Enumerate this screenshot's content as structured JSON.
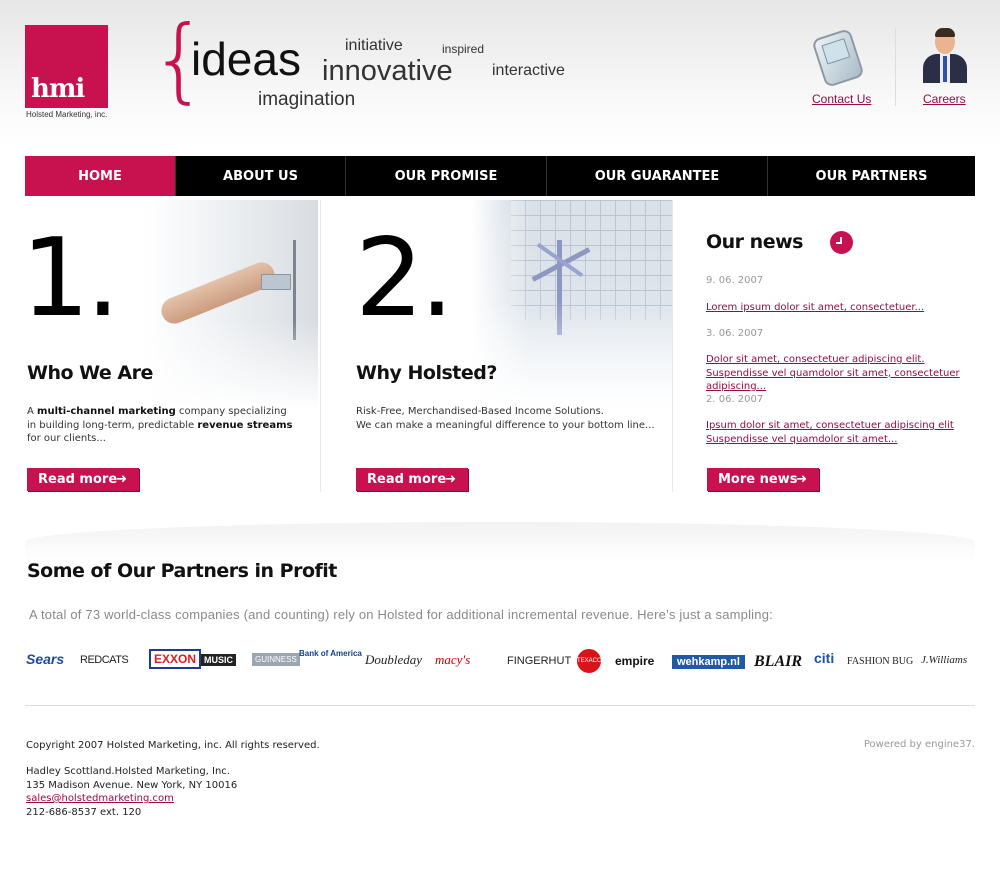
{
  "header": {
    "logo_text": "hmi",
    "logo_subtitle": "Holsted Marketing, inc.",
    "tagline": {
      "ideas": "ideas",
      "initiative": "initiative",
      "inspired": "inspired",
      "innovative": "innovative",
      "interactive": "interactive",
      "imagination": "imagination"
    },
    "contact_label": "Contact Us",
    "careers_label": "Careers",
    "accent_color": "#c8124f"
  },
  "nav": {
    "items": [
      {
        "label": "HOME",
        "active": true
      },
      {
        "label": "ABOUT US",
        "active": false
      },
      {
        "label": "OUR PROMISE",
        "active": false
      },
      {
        "label": "OUR GUARANTEE",
        "active": false
      },
      {
        "label": "OUR PARTNERS",
        "active": false
      }
    ]
  },
  "sections": [
    {
      "number": "1.",
      "title": "Who We Are",
      "text_parts": [
        "A ",
        "multi-channel marketing",
        " company specializing in building long-term, predictable ",
        "revenue streams",
        " for our clients..."
      ],
      "button": "Read more"
    },
    {
      "number": "2.",
      "title": "Why Holsted?",
      "text_line1": "Risk-Free, Merchandised-Based Income Solutions.",
      "text_line2": "We can make a meaningful difference to your bottom line...",
      "button": "Read more"
    }
  ],
  "news": {
    "title": "Our news",
    "items": [
      {
        "date": "9. 06. 2007",
        "text": "Lorem ipsum dolor sit amet, consectetuer..."
      },
      {
        "date": "3. 06. 2007",
        "text": "Dolor sit amet, consectetuer adipiscing elit. Suspendisse vel quamdolor sit amet, consectetuer adipiscing..."
      },
      {
        "date": "2. 06. 2007",
        "text": "Ipsum dolor sit amet, consectetuer adipiscing elit Suspendisse vel quamdolor sit amet..."
      }
    ],
    "button": "More news"
  },
  "partners": {
    "title": "Some of Our Partners in Profit",
    "subtitle": "A total of 73 world-class companies (and counting) rely on Holsted for additional incremental revenue. Here’s just a sampling:",
    "logos": [
      "Sears",
      "REDCATS",
      "EXXON",
      "MUSIC",
      "GUINNESS",
      "Bank of America",
      "Doubleday",
      "macy's",
      "FINGERHUT",
      "TEXACO",
      "empire",
      "wehkamp.nl",
      "BLAIR",
      "citi",
      "FASHION BUG",
      "J.Williams"
    ]
  },
  "footer": {
    "copyright": "Copyright 2007 Holsted Marketing, inc. All rights reserved.",
    "powered": "Powered by engine37.",
    "address_name": "Hadley Scottland.Holsted Marketing, Inc.",
    "address_street": "135 Madison Avenue. New York, NY 10016",
    "email": "sales@holstedmarketing.com",
    "phone": "212-686-8537 ext. 120"
  }
}
